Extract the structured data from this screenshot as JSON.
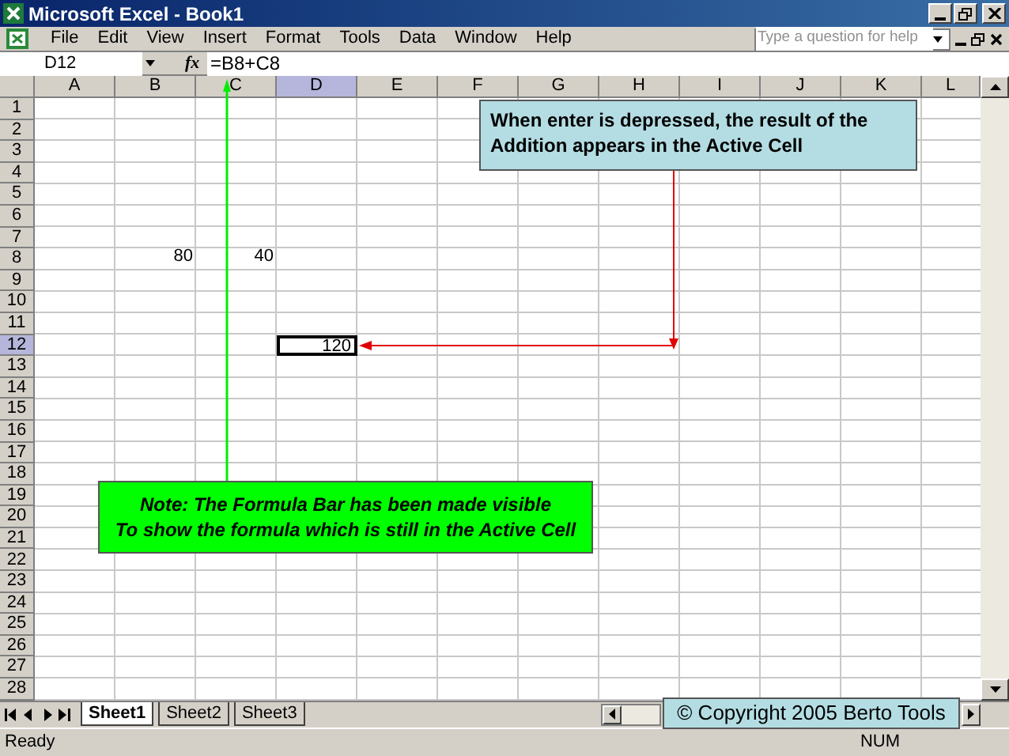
{
  "window": {
    "title": "Microsoft Excel - Book1"
  },
  "menu": [
    "File",
    "Edit",
    "View",
    "Insert",
    "Format",
    "Tools",
    "Data",
    "Window",
    "Help"
  ],
  "help_box": {
    "placeholder": "Type a question for help"
  },
  "formula_bar": {
    "name_box": "D12",
    "fx": "fx",
    "formula": "=B8+C8"
  },
  "columns": [
    {
      "label": "A",
      "selected": false
    },
    {
      "label": "B",
      "selected": false
    },
    {
      "label": "C",
      "selected": false
    },
    {
      "label": "D",
      "selected": true
    },
    {
      "label": "E",
      "selected": false
    },
    {
      "label": "F",
      "selected": false
    },
    {
      "label": "G",
      "selected": false
    },
    {
      "label": "H",
      "selected": false
    },
    {
      "label": "I",
      "selected": false
    },
    {
      "label": "J",
      "selected": false
    },
    {
      "label": "K",
      "selected": false
    },
    {
      "label": "L",
      "selected": false
    }
  ],
  "rows": [
    {
      "label": "1",
      "selected": false
    },
    {
      "label": "2",
      "selected": false
    },
    {
      "label": "3",
      "selected": false
    },
    {
      "label": "4",
      "selected": false
    },
    {
      "label": "5",
      "selected": false
    },
    {
      "label": "6",
      "selected": false
    },
    {
      "label": "7",
      "selected": false
    },
    {
      "label": "8",
      "selected": false,
      "cells": [
        null,
        {
          "value": "80",
          "selected": false
        },
        {
          "value": "40",
          "selected": false
        }
      ]
    },
    {
      "label": "9",
      "selected": false
    },
    {
      "label": "10",
      "selected": false
    },
    {
      "label": "11",
      "selected": false
    },
    {
      "label": "12",
      "selected": true,
      "cells": [
        null,
        null,
        null,
        {
          "value": "120",
          "selected": true
        }
      ]
    },
    {
      "label": "13",
      "selected": false
    },
    {
      "label": "14",
      "selected": false
    },
    {
      "label": "15",
      "selected": false
    },
    {
      "label": "16",
      "selected": false
    },
    {
      "label": "17",
      "selected": false
    },
    {
      "label": "18",
      "selected": false
    },
    {
      "label": "19",
      "selected": false
    },
    {
      "label": "20",
      "selected": false
    },
    {
      "label": "21",
      "selected": false
    },
    {
      "label": "22",
      "selected": false
    },
    {
      "label": "23",
      "selected": false
    },
    {
      "label": "24",
      "selected": false
    },
    {
      "label": "25",
      "selected": false
    },
    {
      "label": "26",
      "selected": false
    },
    {
      "label": "27",
      "selected": false
    },
    {
      "label": "28",
      "selected": false
    }
  ],
  "callouts": [
    {
      "kind": "result",
      "text": "When enter is depressed, the result of the Addition appears in the Active Cell"
    },
    {
      "kind": "note",
      "text": "Note: The Formula Bar has been made visible\nTo show the formula which is still in the Active Cell"
    },
    {
      "kind": "copyright",
      "text": "© Copyright 2005 Berto Tools"
    }
  ],
  "sheet_tabs": [
    {
      "label": "Sheet1",
      "selected": true
    },
    {
      "label": "Sheet2",
      "selected": false
    },
    {
      "label": "Sheet3",
      "selected": false
    }
  ],
  "status_bar": {
    "left": "Ready",
    "right": "NUM"
  }
}
